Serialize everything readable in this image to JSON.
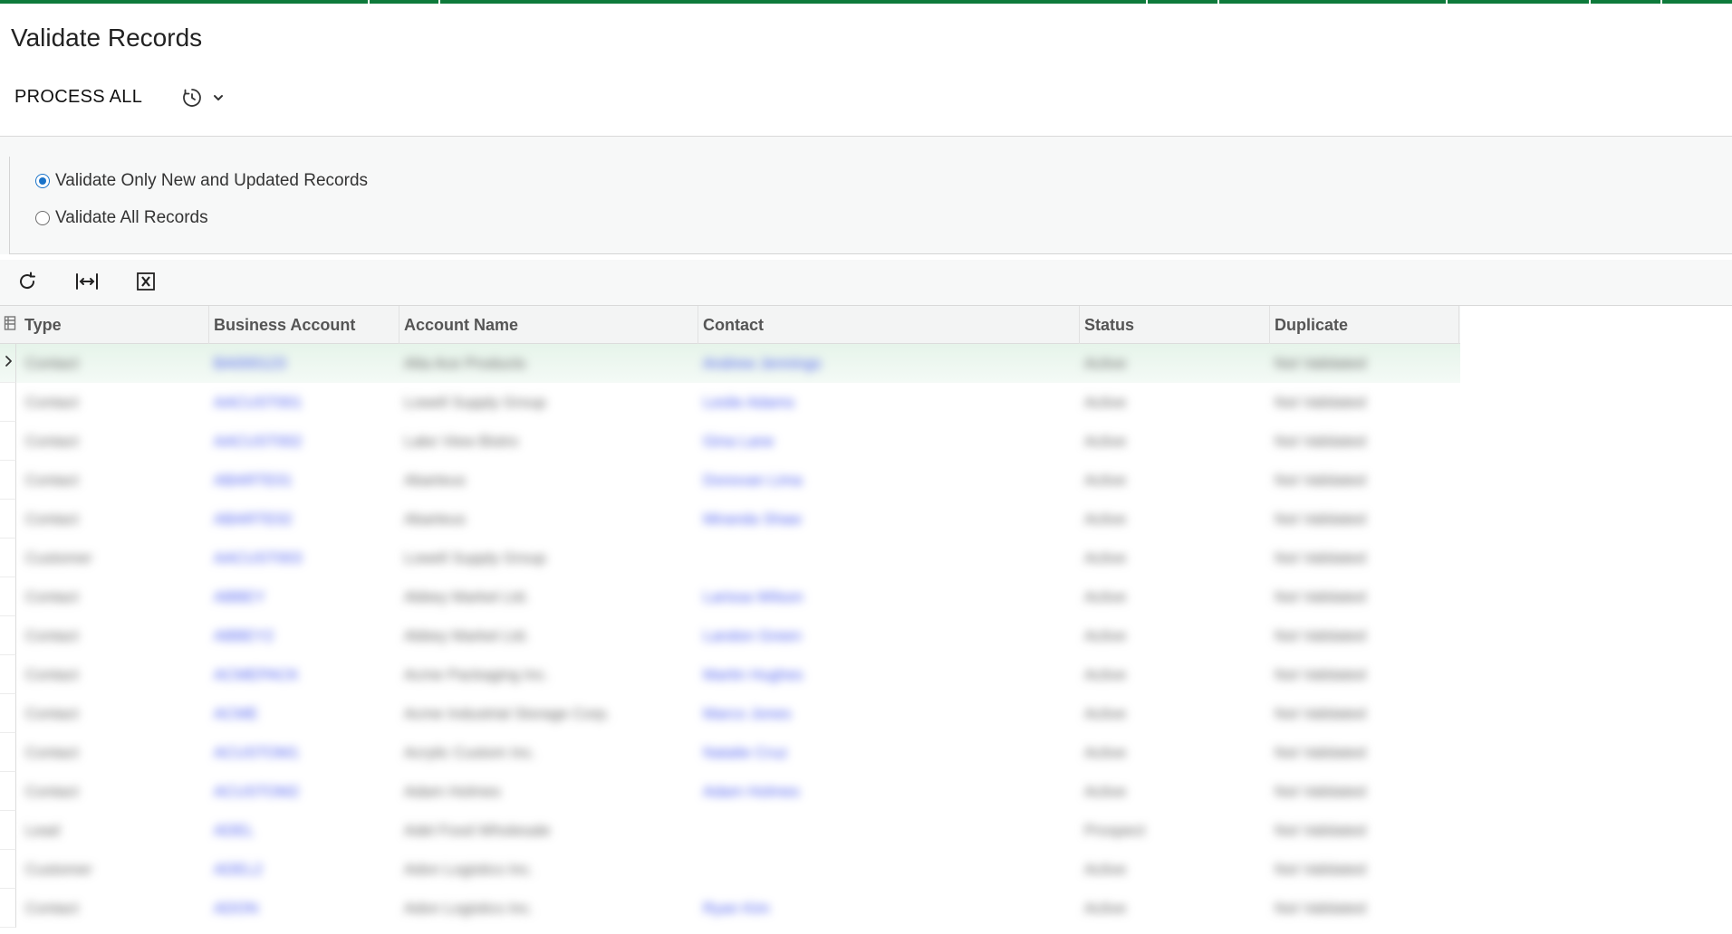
{
  "page": {
    "title": "Validate Records"
  },
  "toolbar": {
    "process_all_label": "PROCESS ALL"
  },
  "filter": {
    "options": [
      {
        "label": "Validate Only New and Updated Records",
        "checked": true
      },
      {
        "label": "Validate All Records",
        "checked": false
      }
    ]
  },
  "grid": {
    "columns": [
      "Type",
      "Business Account",
      "Account Name",
      "Contact",
      "Status",
      "Duplicate"
    ],
    "rows": [
      [
        "Contact",
        "BA000123",
        "Alta Ace Products",
        "Andrew Jennings",
        "Active",
        "Not Validated"
      ],
      [
        "Contact",
        "AACUST001",
        "Lowell Supply Group",
        "Leslie Adams",
        "Active",
        "Not Validated"
      ],
      [
        "Contact",
        "AACUST002",
        "Lake View Bistro",
        "Gina Lane",
        "Active",
        "Not Validated"
      ],
      [
        "Contact",
        "ABARTE01",
        "Abarteus",
        "Donovan Lima",
        "Active",
        "Not Validated"
      ],
      [
        "Contact",
        "ABARTE02",
        "Abarteus",
        "Miranda Shaw",
        "Active",
        "Not Validated"
      ],
      [
        "Customer",
        "AACUST003",
        "Lowell Supply Group",
        "",
        "Active",
        "Not Validated"
      ],
      [
        "Contact",
        "ABBEY",
        "Abbey Market Ltd.",
        "Larissa Wilson",
        "Active",
        "Not Validated"
      ],
      [
        "Contact",
        "ABBEY2",
        "Abbey Market Ltd.",
        "Landon Green",
        "Active",
        "Not Validated"
      ],
      [
        "Contact",
        "ACMEPACK",
        "Acme Packaging Inc.",
        "Martin Hughes",
        "Active",
        "Not Validated"
      ],
      [
        "Contact",
        "ACME",
        "Acme Industrial Storage Corp.",
        "Marco Jones",
        "Active",
        "Not Validated"
      ],
      [
        "Contact",
        "ACUSTOM1",
        "Acrylic Custom Inc.",
        "Natalie Cruz",
        "Active",
        "Not Validated"
      ],
      [
        "Contact",
        "ACUSTOM2",
        "Adam Holmes",
        "Adam Holmes",
        "Active",
        "Not Validated"
      ],
      [
        "Lead",
        "ADEL",
        "Adel Food Wholesale",
        "",
        "Prospect",
        "Not Validated"
      ],
      [
        "Customer",
        "ADEL2",
        "Adon Logistics Inc.",
        "",
        "Active",
        "Not Validated"
      ],
      [
        "Contact",
        "ADON",
        "Adon Logistics Inc.",
        "Ryan Kim",
        "Active",
        "Not Validated"
      ]
    ]
  },
  "icons": {
    "schedule": "clock-history-icon",
    "dropdown": "chevron-down-icon",
    "refresh": "refresh-icon",
    "fit_columns": "fit-columns-icon",
    "export_excel": "excel-export-icon",
    "row_selector_header": "column-chooser-icon",
    "row_expand": "chevron-right-icon"
  },
  "colors": {
    "accent": "#0e7a3b",
    "link": "#4a5cf0",
    "radio": "#1a73c9"
  }
}
